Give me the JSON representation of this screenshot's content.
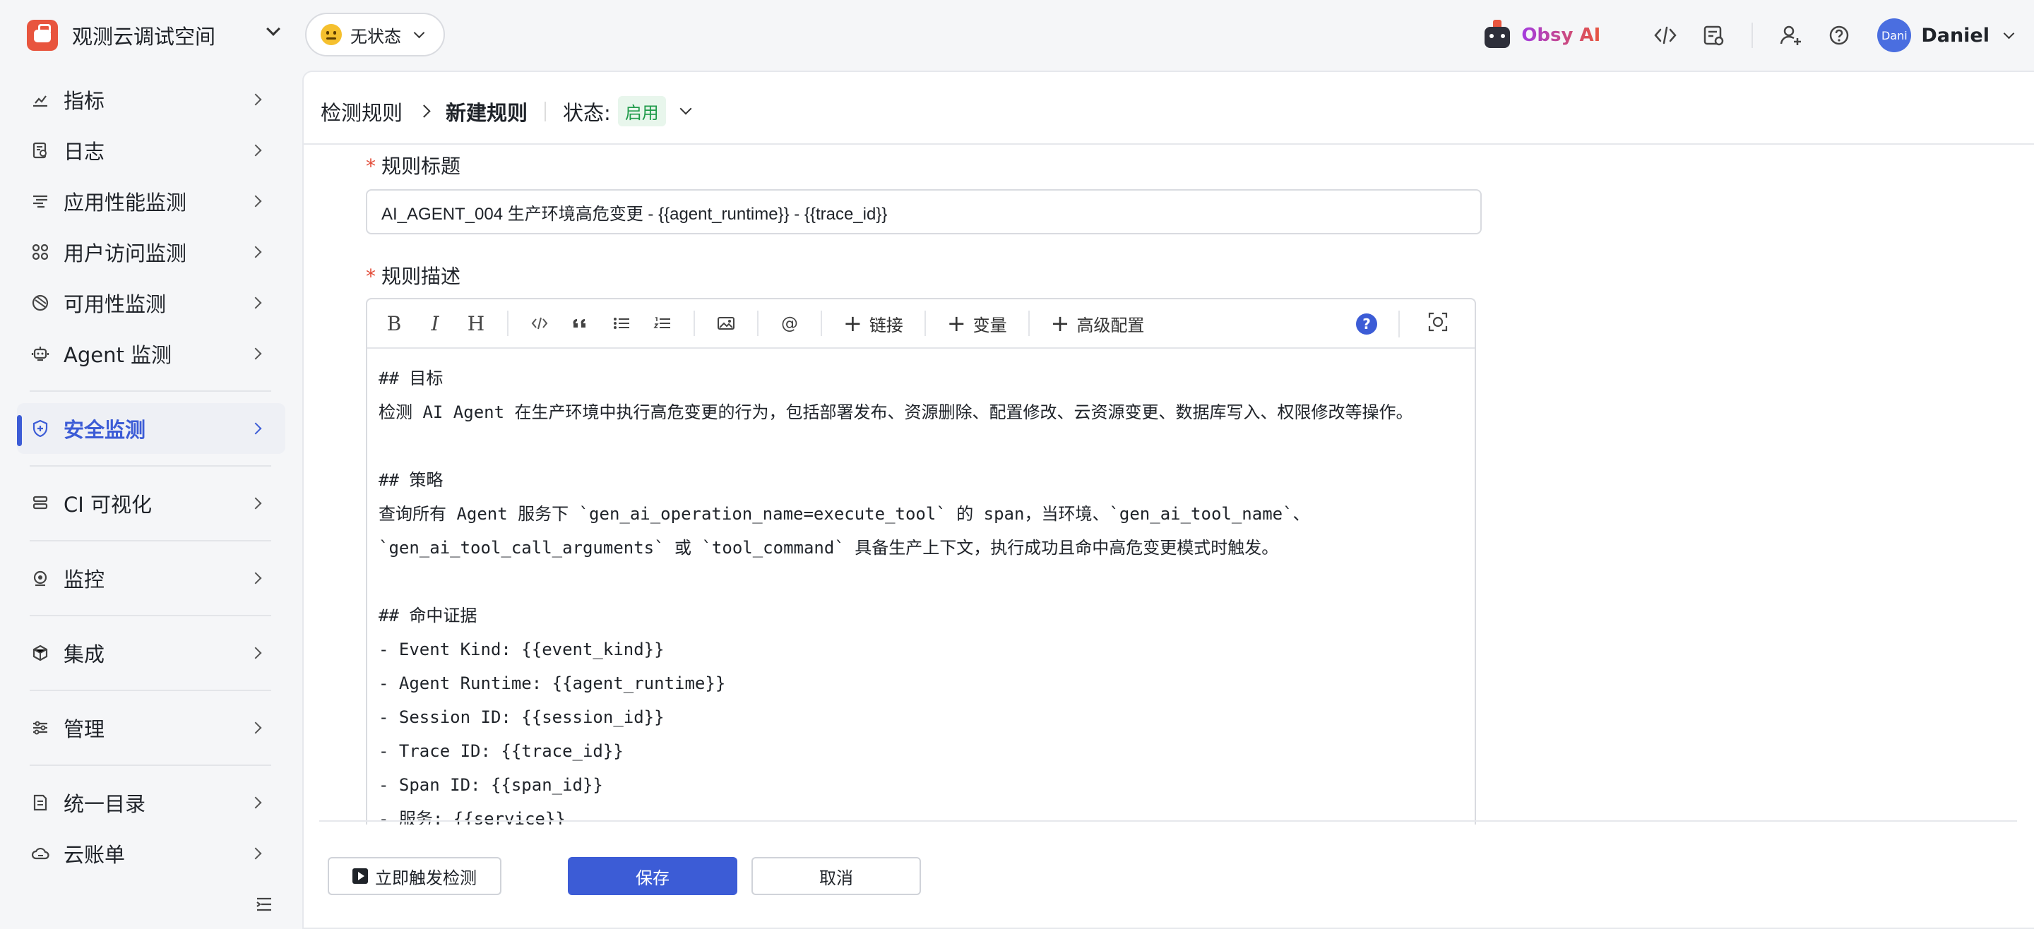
{
  "workspace": {
    "name": "观测云调试空间",
    "status": "无状态"
  },
  "topbar": {
    "ai_label": "Obsy AI",
    "user_initials": "Dani",
    "user_name": "Daniel"
  },
  "sidebar": {
    "items": [
      {
        "label": "指标",
        "icon": "metrics-icon"
      },
      {
        "label": "日志",
        "icon": "log-icon"
      },
      {
        "label": "应用性能监测",
        "icon": "apm-icon"
      },
      {
        "label": "用户访问监测",
        "icon": "rum-icon"
      },
      {
        "label": "可用性监测",
        "icon": "availability-icon"
      },
      {
        "label": "Agent 监测",
        "icon": "agent-icon"
      },
      {
        "label": "安全监测",
        "icon": "security-icon",
        "active": true
      },
      {
        "label": "CI 可视化",
        "icon": "ci-icon"
      },
      {
        "label": "监控",
        "icon": "monitor-icon"
      },
      {
        "label": "集成",
        "icon": "integration-icon"
      },
      {
        "label": "管理",
        "icon": "manage-icon"
      },
      {
        "label": "统一目录",
        "icon": "catalog-icon"
      },
      {
        "label": "云账单",
        "icon": "billing-icon"
      }
    ]
  },
  "breadcrumb": {
    "parent": "检测规则",
    "current": "新建规则",
    "status_label": "状态:",
    "status_value": "启用"
  },
  "form": {
    "title_label": "规则标题",
    "title_value": "AI_AGENT_004 生产环境高危变更 - {{agent_runtime}} - {{trace_id}}",
    "desc_label": "规则描述",
    "required_mark": "*"
  },
  "editor": {
    "toolbar": {
      "link": "链接",
      "variable": "变量",
      "advanced": "高级配置",
      "help": "?"
    },
    "lines": [
      "## 目标",
      "检测 AI Agent 在生产环境中执行高危变更的行为，包括部署发布、资源删除、配置修改、云资源变更、数据库写入、权限修改等操作。",
      "",
      "## 策略",
      "查询所有 Agent 服务下 `gen_ai_operation_name=execute_tool` 的 span，当环境、`gen_ai_tool_name`、",
      "`gen_ai_tool_call_arguments` 或 `tool_command` 具备生产上下文，执行成功且命中高危变更模式时触发。",
      "",
      "## 命中证据",
      "- Event Kind: {{event_kind}}",
      "- Agent Runtime: {{agent_runtime}}",
      "- Session ID: {{session_id}}",
      "- Trace ID: {{trace_id}}",
      "- Span ID: {{span_id}}",
      "- 服务: {{service}}"
    ]
  },
  "buttons": {
    "trigger": "立即触发检测",
    "save": "保存",
    "cancel": "取消"
  },
  "colors": {
    "accent": "#3c5cd6",
    "status_green": "#1f9b4a",
    "required": "#e34d3a"
  }
}
